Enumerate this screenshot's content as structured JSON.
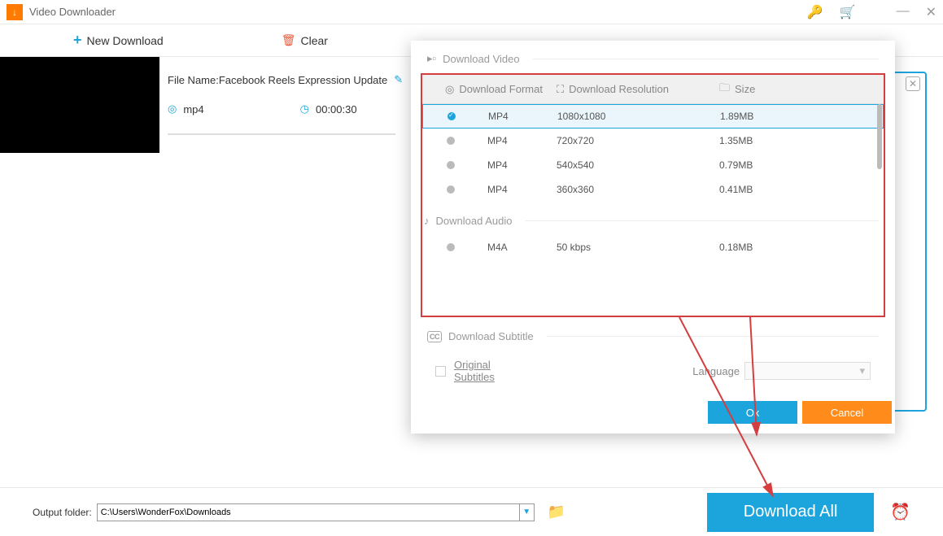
{
  "title": "Video Downloader",
  "toolbar": {
    "new_download": "New Download",
    "clear": "Clear"
  },
  "file": {
    "name_label": "File Name: ",
    "name": "Facebook Reels Expression Update",
    "format": "mp4",
    "duration": "00:00:30"
  },
  "dialog": {
    "download_video": "Download Video",
    "download_audio": "Download Audio",
    "download_subtitle": "Download Subtitle",
    "headers": {
      "format": "Download Format",
      "resolution": "Download Resolution",
      "size": "Size"
    },
    "video_rows": [
      {
        "fmt": "MP4",
        "res": "1080x1080",
        "size": "1.89MB",
        "selected": true
      },
      {
        "fmt": "MP4",
        "res": "720x720",
        "size": "1.35MB",
        "selected": false
      },
      {
        "fmt": "MP4",
        "res": "540x540",
        "size": "0.79MB",
        "selected": false
      },
      {
        "fmt": "MP4",
        "res": "360x360",
        "size": "0.41MB",
        "selected": false
      }
    ],
    "audio_rows": [
      {
        "fmt": "M4A",
        "res": "50 kbps",
        "size": "0.18MB",
        "selected": false
      }
    ],
    "original_subtitles": "Original Subtitles",
    "language_label": "Language",
    "ok": "Ok",
    "cancel": "Cancel"
  },
  "footer": {
    "output_label": "Output folder:",
    "output_path": "C:\\Users\\WonderFox\\Downloads",
    "download_all": "Download All"
  }
}
